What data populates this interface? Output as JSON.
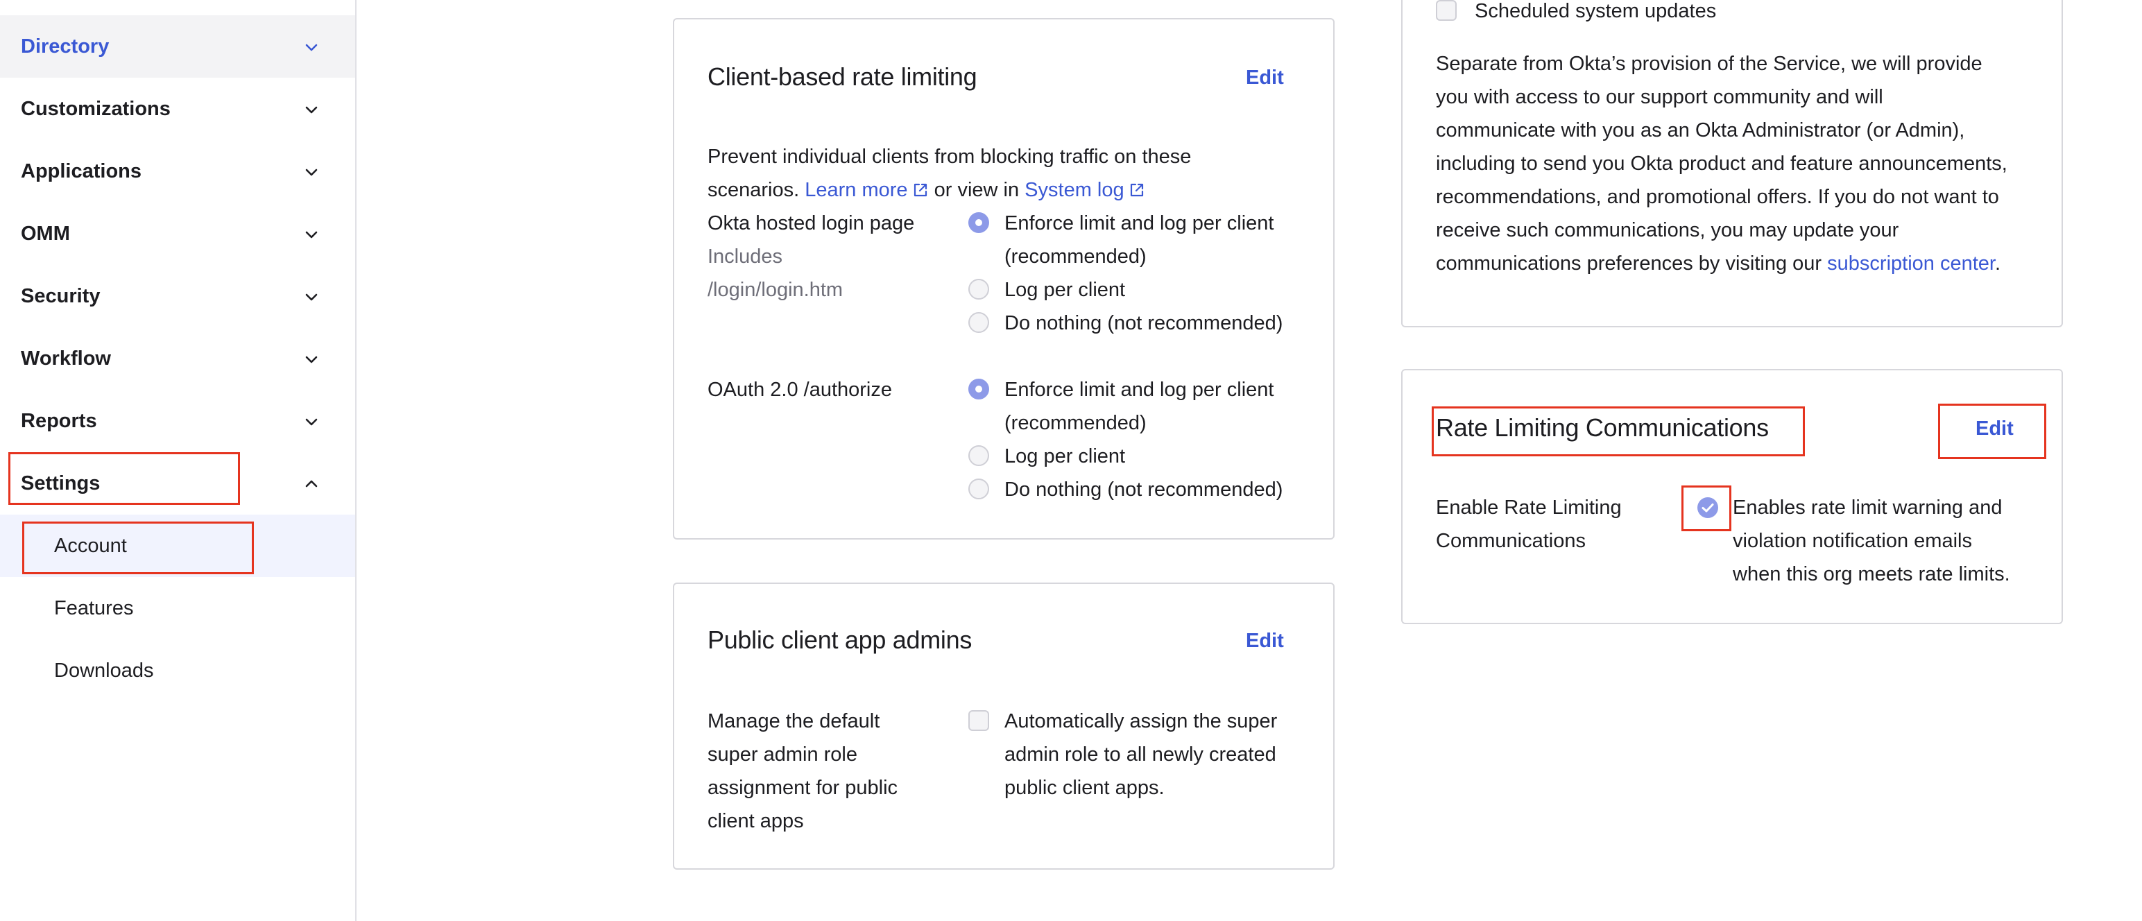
{
  "sidebar": {
    "items": [
      {
        "label": "Directory"
      },
      {
        "label": "Customizations"
      },
      {
        "label": "Applications"
      },
      {
        "label": "OMM"
      },
      {
        "label": "Security"
      },
      {
        "label": "Workflow"
      },
      {
        "label": "Reports"
      },
      {
        "label": "Settings"
      }
    ],
    "settings_sub": [
      {
        "label": "Account"
      },
      {
        "label": "Features"
      },
      {
        "label": "Downloads"
      }
    ]
  },
  "client_rate": {
    "title": "Client-based rate limiting",
    "edit_label": "Edit",
    "desc_line1": "Prevent individual clients from blocking traffic on these",
    "desc_prefix": "scenarios.",
    "learn_more": "Learn more",
    "or_view_in": "or view in",
    "system_log": "System log",
    "okta_hosted": {
      "label": "Okta hosted login page",
      "note_line1": "Includes",
      "note_line2": "/login/login.htm",
      "options": [
        "Enforce limit and log per client",
        "(recommended)",
        "Log per client",
        "Do nothing (not recommended)"
      ]
    },
    "oauth": {
      "label": "OAuth 2.0 /authorize",
      "options": [
        "Enforce limit and log per client",
        "(recommended)",
        "Log per client",
        "Do nothing (not recommended)"
      ]
    }
  },
  "public_client": {
    "title": "Public client app admins",
    "edit_label": "Edit",
    "desc": [
      "Manage the default",
      "super admin role",
      "assignment for public",
      "client apps"
    ],
    "option": [
      "Automatically assign the super",
      "admin role to all newly created",
      "public client apps."
    ]
  },
  "comms": {
    "scheduled_label": "Scheduled system updates",
    "para": [
      "Separate from Okta’s provision of the Service, we will provide",
      "you with access to our support community and will",
      "communicate with you as an Okta Administrator (or Admin),",
      "including to send you Okta product and feature announcements,",
      "recommendations, and promotional offers. If you do not want to",
      "receive such communications, you may update your"
    ],
    "para_last_prefix": "communications preferences by visiting our",
    "subscription_center": "subscription center",
    "para_last_suffix": "."
  },
  "rate_comm": {
    "title": "Rate Limiting Communications",
    "edit_label": "Edit",
    "field_label": [
      "Enable Rate Limiting",
      "Communications"
    ],
    "value": [
      "Enables rate limit warning and",
      "violation notification emails",
      "when this org meets rate limits."
    ],
    "checked": true
  },
  "colors": {
    "accent": "#3a58d4",
    "highlight_box": "#e5341f",
    "selected_radio": "#8d9ae8"
  }
}
